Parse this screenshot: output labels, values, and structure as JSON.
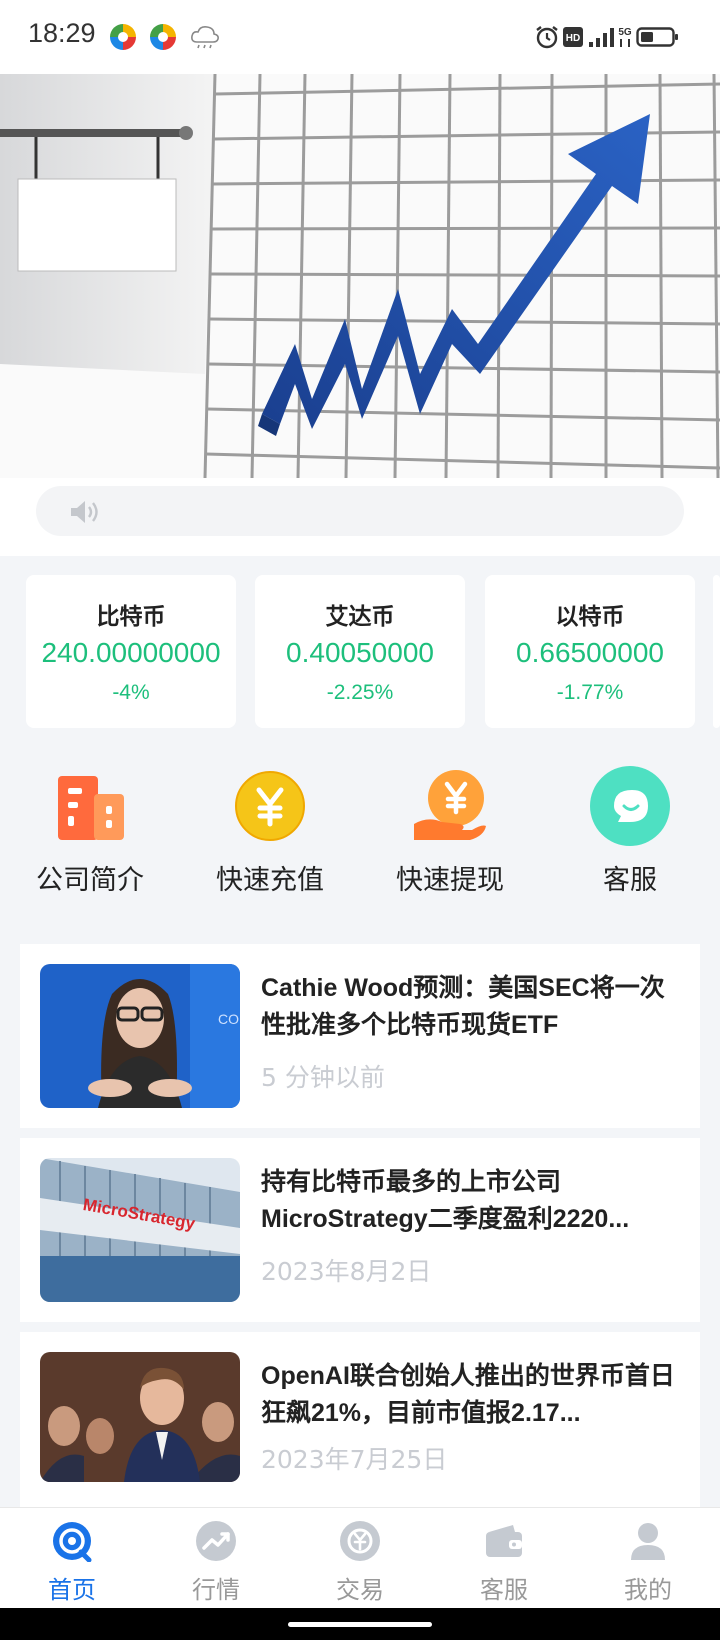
{
  "status_bar": {
    "time": "18:29",
    "icons": [
      "app-icon",
      "app-icon",
      "cloud-icon",
      "alarm-icon",
      "hd-icon",
      "signal-icon",
      "5g-icon",
      "battery-icon"
    ]
  },
  "banner": {
    "slides": 3,
    "active_slide": 1
  },
  "notice": {
    "icon": "speaker-icon"
  },
  "tickers": [
    {
      "name": "比特币",
      "price": "240.00000000",
      "change": "-4%"
    },
    {
      "name": "艾达币",
      "price": "0.40050000",
      "change": "-2.25%"
    },
    {
      "name": "以特币",
      "price": "0.66500000",
      "change": "-1.77%"
    }
  ],
  "quick_actions": [
    {
      "label": "公司简介",
      "icon": "building-icon"
    },
    {
      "label": "快速充值",
      "icon": "yen-coin-icon"
    },
    {
      "label": "快速提现",
      "icon": "yen-hand-icon"
    },
    {
      "label": "客服",
      "icon": "chat-bubble-icon"
    }
  ],
  "news": [
    {
      "title": "Cathie Wood预测：美国SEC将一次性批准多个比特币现货ETF",
      "time": "5 分钟以前"
    },
    {
      "title": "持有比特币最多的上市公司MicroStrategy二季度盈利2220...",
      "time": "2023年8月2日",
      "sign_text": "MicroStrategy"
    },
    {
      "title": "OpenAI联合创始人推出的世界币首日狂飙21%，目前市值报2.17...",
      "time": "2023年7月25日"
    }
  ],
  "tab_bar": [
    {
      "label": "首页",
      "icon": "home-icon",
      "active": true
    },
    {
      "label": "行情",
      "icon": "chart-trend-icon",
      "active": false
    },
    {
      "label": "交易",
      "icon": "exchange-icon",
      "active": false
    },
    {
      "label": "客服",
      "icon": "wallet-icon",
      "active": false
    },
    {
      "label": "我的",
      "icon": "user-icon",
      "active": false
    }
  ],
  "colors": {
    "accent": "#1a73e8",
    "up_green": "#1dbf7c",
    "muted_text": "#c9ccd2",
    "banner_arrow": "#1f4fa8"
  }
}
